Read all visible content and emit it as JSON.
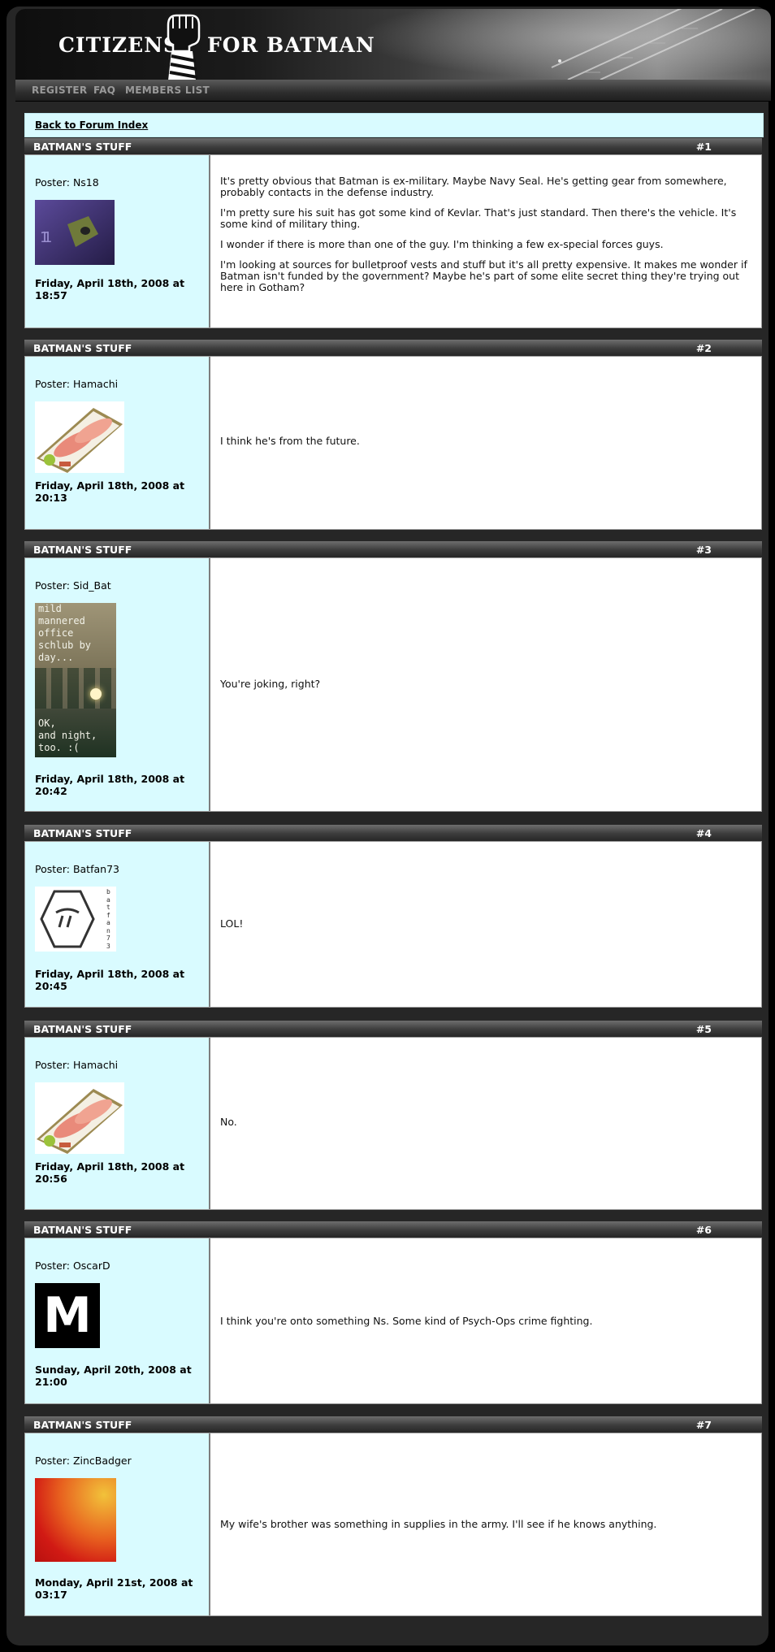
{
  "header": {
    "logo_left": "CITIZENS",
    "logo_right": "FOR BATMAN"
  },
  "nav": {
    "items": [
      "REGISTER",
      "FAQ",
      "MEMBERS LIST"
    ]
  },
  "back_link": "Back to Forum Index",
  "posts": [
    {
      "thread": "BATMAN'S STUFF",
      "number": "#1",
      "poster": "Poster: Ns18",
      "date": "Friday, April 18th, 2008 at 18:57",
      "paragraphs": [
        "It's pretty obvious that Batman is ex-military. Maybe Navy Seal. He's getting gear from somewhere, probably contacts in the defense industry.",
        "I'm pretty sure his suit has got some kind of Kevlar. That's just standard. Then there's the vehicle. It's some kind of military thing.",
        "I wonder if there is more than one of the guy. I'm thinking a few ex-special forces guys.",
        "I'm looking at sources for bulletproof vests and stuff but it's all pretty expensive. It makes me wonder if Batman isn't funded by the government? Maybe he's part of some elite secret thing they're trying out here in Gotham?"
      ]
    },
    {
      "thread": "BATMAN'S STUFF",
      "number": "#2",
      "poster": "Poster: Hamachi",
      "date": "Friday, April 18th, 2008 at 20:13",
      "paragraphs": [
        "I think he's from the future."
      ]
    },
    {
      "thread": "BATMAN'S STUFF",
      "number": "#3",
      "poster": "Poster: Sid_Bat",
      "date": "Friday, April 18th, 2008 at 20:42",
      "paragraphs": [
        "You're joking, right?"
      ],
      "avatar_text": [
        "mild",
        "mannered",
        "office",
        "schlub by",
        "day...",
        "OK,",
        "and night,",
        "too. :("
      ]
    },
    {
      "thread": "BATMAN'S STUFF",
      "number": "#4",
      "poster": "Poster: Batfan73",
      "date": "Friday, April 18th, 2008 at 20:45",
      "paragraphs": [
        "LOL!"
      ],
      "avatar_text": "batfan73"
    },
    {
      "thread": "BATMAN'S STUFF",
      "number": "#5",
      "poster": "Poster: Hamachi",
      "date": "Friday, April 18th, 2008 at 20:56",
      "paragraphs": [
        "No."
      ]
    },
    {
      "thread": "BATMAN'S STUFF",
      "number": "#6",
      "poster": "Poster: OscarD",
      "date": "Sunday, April 20th, 2008 at 21:00",
      "paragraphs": [
        "I think you're onto something Ns. Some kind of Psych-Ops crime fighting."
      ],
      "avatar_text": "M"
    },
    {
      "thread": "BATMAN'S STUFF",
      "number": "#7",
      "poster": "Poster: ZincBadger",
      "date": "Monday, April 21st, 2008 at 03:17",
      "paragraphs": [
        "My wife's brother was something in supplies in the army. I'll see if he knows anything."
      ]
    }
  ]
}
